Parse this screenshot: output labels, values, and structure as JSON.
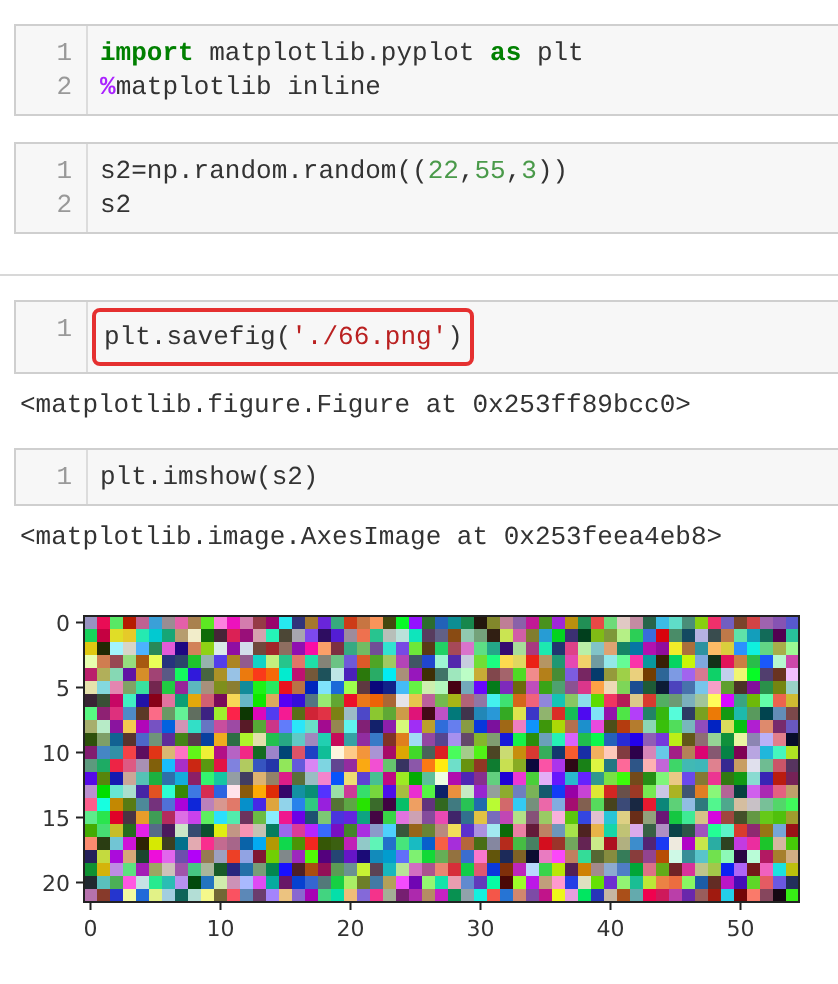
{
  "cells": [
    {
      "highlighted": false,
      "lines": [
        {
          "number": "1",
          "tokens": [
            {
              "kind": "keyword",
              "text": "import"
            },
            {
              "kind": "plain",
              "text": " matplotlib.pyplot "
            },
            {
              "kind": "keyword",
              "text": "as"
            },
            {
              "kind": "plain",
              "text": " plt"
            }
          ]
        },
        {
          "number": "2",
          "tokens": [
            {
              "kind": "magic",
              "text": "%"
            },
            {
              "kind": "plain",
              "text": "matplotlib inline"
            }
          ]
        }
      ]
    },
    {
      "highlighted": false,
      "rule_after": true,
      "lines": [
        {
          "number": "1",
          "tokens": [
            {
              "kind": "plain",
              "text": "s2=np.random.random(("
            },
            {
              "kind": "number",
              "text": "22"
            },
            {
              "kind": "plain",
              "text": ","
            },
            {
              "kind": "number",
              "text": "55"
            },
            {
              "kind": "plain",
              "text": ","
            },
            {
              "kind": "number",
              "text": "3"
            },
            {
              "kind": "plain",
              "text": "))"
            }
          ]
        },
        {
          "number": "2",
          "tokens": [
            {
              "kind": "plain",
              "text": "s2"
            }
          ]
        }
      ]
    },
    {
      "highlighted": true,
      "output": "<matplotlib.figure.Figure at 0x253ff89bcc0>",
      "lines": [
        {
          "number": "1",
          "tokens": [
            {
              "kind": "plain",
              "text": "plt.savefig("
            },
            {
              "kind": "string",
              "text": "'./66.png'"
            },
            {
              "kind": "plain",
              "text": ")"
            }
          ]
        }
      ]
    },
    {
      "highlighted": false,
      "output": "<matplotlib.image.AxesImage at 0x253feea4eb8>",
      "plot": {
        "yticks": [
          "0",
          "5",
          "10",
          "15",
          "20"
        ],
        "xticks": [
          "0",
          "10",
          "20",
          "30",
          "40",
          "50"
        ]
      },
      "lines": [
        {
          "number": "1",
          "tokens": [
            {
              "kind": "plain",
              "text": "plt.imshow(s2)"
            }
          ]
        }
      ]
    }
  ]
}
